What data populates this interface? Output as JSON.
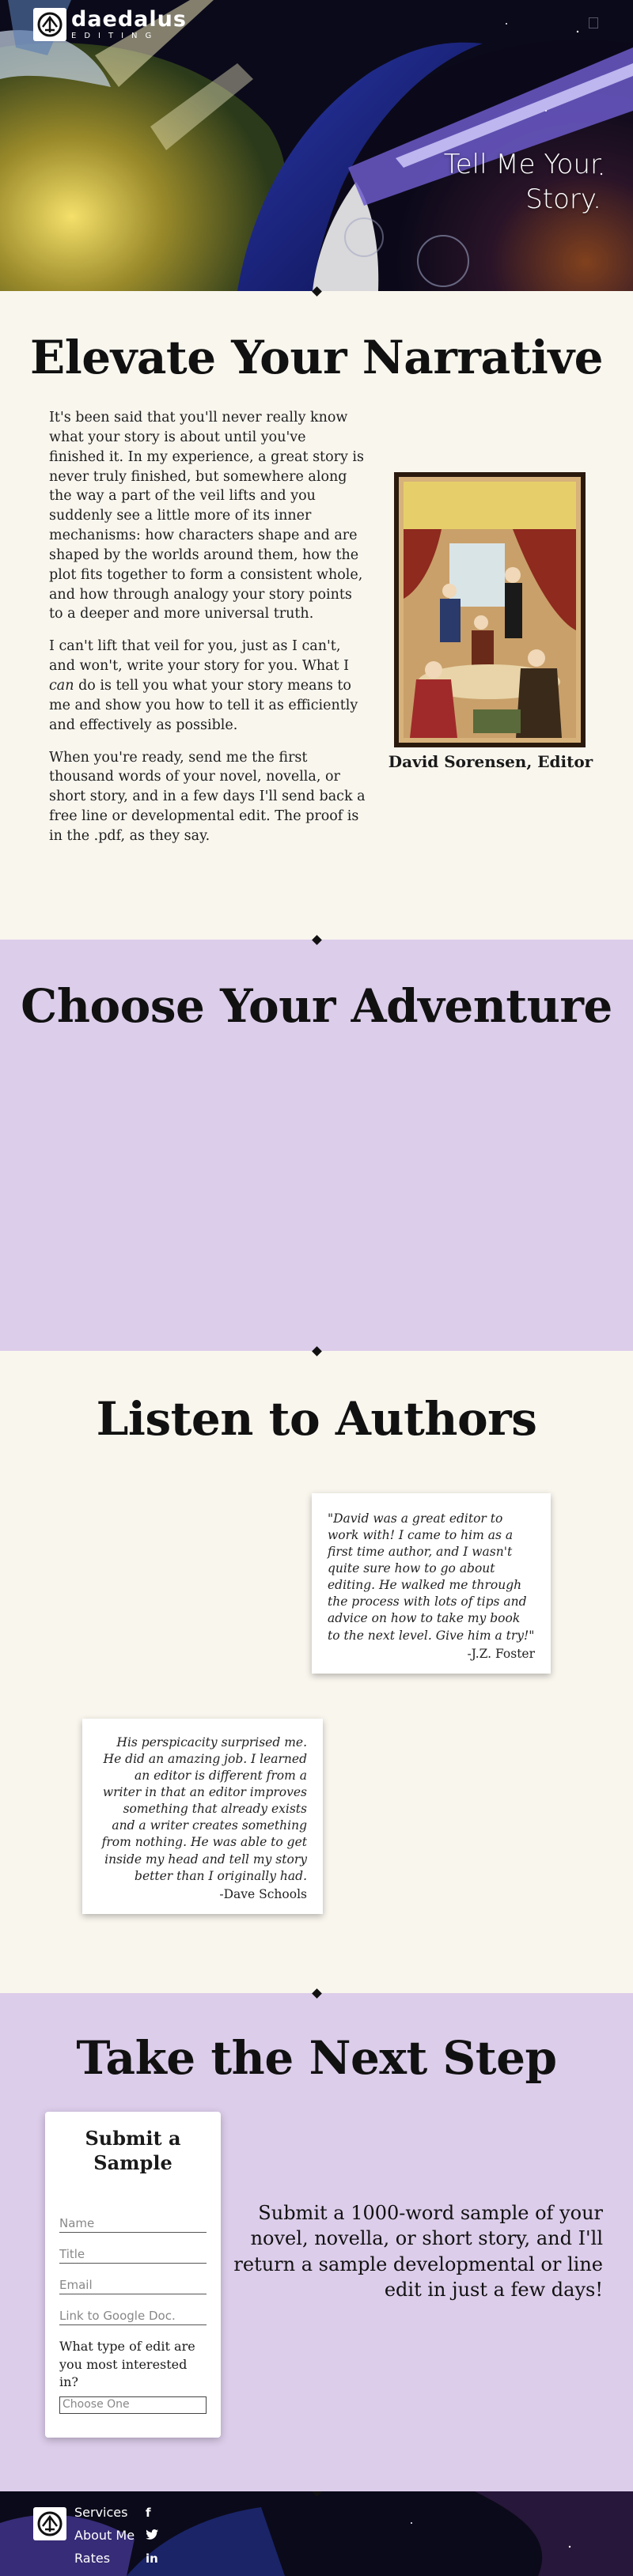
{
  "brand": {
    "name": "daedalus",
    "subtitle": "EDITING",
    "logo_icon": "daedalus-glyph-icon"
  },
  "header": {
    "menu_icon": "menu-toggle-icon"
  },
  "hero": {
    "tagline": "Tell Me Your Story."
  },
  "narrative": {
    "title": "Elevate Your Narrative",
    "paragraphs": [
      "It's been said that you'll never really know what your story is about until you've finished it. In my experience, a great story is never truly finished, but somewhere along the way a part of the veil lifts and you suddenly see a little more of its inner mechanisms: how characters shape and are shaped by the worlds around them, how the plot fits together to form a consistent whole, and how through analogy your story points to a deeper and more universal truth."
    ],
    "p2_before": "I can't lift that veil for you, just as I can't, and won't, write your story for you. What I ",
    "p2_emph": "can",
    "p2_after": " do is tell you what your story means to me and show you how to tell it as efficiently and effectively as possible.",
    "p3": "When you're ready, send me the first thousand words of your novel, novella, or short story, and in a few days I'll send back a free line or developmental edit. The proof is in the .pdf, as they say.",
    "editor_caption": "David Sorensen, Editor"
  },
  "adventure": {
    "title": "Choose Your Adventure"
  },
  "authors": {
    "title": "Listen to Authors",
    "testimonials": [
      {
        "quote": "\"David was a great editor to work with! I came to him as a first time author, and I wasn't quite sure how to go about editing. He walked me through the process with lots of tips and advice on how to take my book to the next level. Give him a try!\"",
        "author": "-J.Z. Foster"
      },
      {
        "quote": "His perspicacity surprised me. He did an amazing job. I learned an editor is different from a writer in that an editor improves something that already exists and a writer creates something from nothing. He was able to get inside my head and tell my story better than I originally had.",
        "author": "-Dave Schools"
      }
    ]
  },
  "next_step": {
    "title": "Take the Next Step",
    "form": {
      "heading": "Submit a Sample",
      "name_placeholder": "Name",
      "title_placeholder": "Title",
      "email_placeholder": "Email",
      "link_placeholder": "Link to Google Doc.",
      "question": "What type of edit are you most interested in?",
      "select_value": "Choose One"
    },
    "offer": "Submit a 1000-word sample of your novel, novella, or short story, and I'll return a sample developmental or line edit in just a few days!"
  },
  "footer": {
    "nav": [
      {
        "label": "Services",
        "social": "f",
        "social_icon": "facebook-icon"
      },
      {
        "label": "About Me",
        "social": "🐦",
        "social_icon": "twitter-icon"
      },
      {
        "label": "Rates",
        "social": "in",
        "social_icon": "linkedin-icon"
      }
    ]
  },
  "colors": {
    "cream": "#f9f6ee",
    "lavender": "#dccdea",
    "night": "#0b0a1a"
  }
}
